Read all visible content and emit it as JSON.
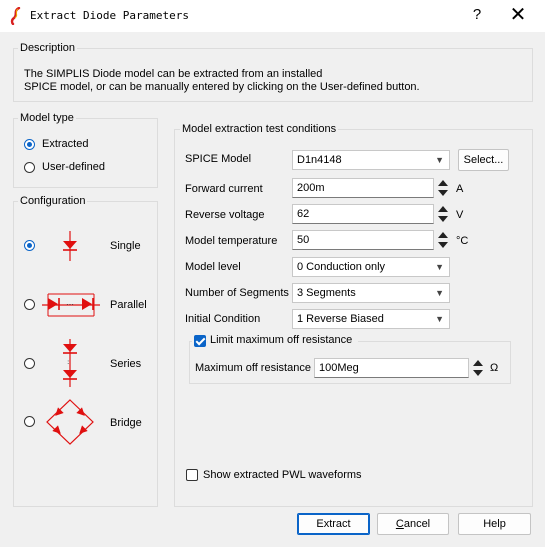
{
  "window": {
    "title": "Extract Diode Parameters",
    "help": "?",
    "close": "✕"
  },
  "description": {
    "group_label": "Description",
    "line1": "The SIMPLIS Diode model can be extracted from an installed",
    "line2": "SPICE model, or can be manually entered by clicking on the User-defined button."
  },
  "model_type": {
    "group_label": "Model type",
    "options": [
      {
        "label": "Extracted",
        "checked": true
      },
      {
        "label": "User-defined",
        "checked": false
      }
    ]
  },
  "configuration": {
    "group_label": "Configuration",
    "options": [
      {
        "label": "Single",
        "checked": true
      },
      {
        "label": "Parallel",
        "checked": false
      },
      {
        "label": "Series",
        "checked": false
      },
      {
        "label": "Bridge",
        "checked": false
      }
    ]
  },
  "conditions": {
    "group_label": "Model extraction test conditions",
    "spice_model": {
      "label": "SPICE Model",
      "value": "D1n4148",
      "select_button": "Select..."
    },
    "forward_current": {
      "label": "Forward current",
      "value": "200m",
      "unit": "A"
    },
    "reverse_voltage": {
      "label": "Reverse voltage",
      "value": "62",
      "unit": "V"
    },
    "model_temperature": {
      "label": "Model temperature",
      "value": "50",
      "unit": "°C"
    },
    "model_level": {
      "label": "Model level",
      "value": "0 Conduction only"
    },
    "number_of_segments": {
      "label": "Number of Segments",
      "value": "3 Segments"
    },
    "initial_condition": {
      "label": "Initial Condition",
      "value": "1 Reverse Biased"
    },
    "limit_off_resistance": {
      "label": "Limit maximum off resistance",
      "checked": true
    },
    "max_off_resistance": {
      "label": "Maximum off resistance",
      "value": "100Meg",
      "unit": "Ω"
    },
    "show_pwl": {
      "label": "Show extracted PWL waveforms",
      "checked": false
    }
  },
  "buttons": {
    "extract": "Extract",
    "cancel_first": "C",
    "cancel_rest": "ancel",
    "help": "Help"
  },
  "colors": {
    "diode_red": "#e01010",
    "accent_blue": "#0a64c8"
  }
}
